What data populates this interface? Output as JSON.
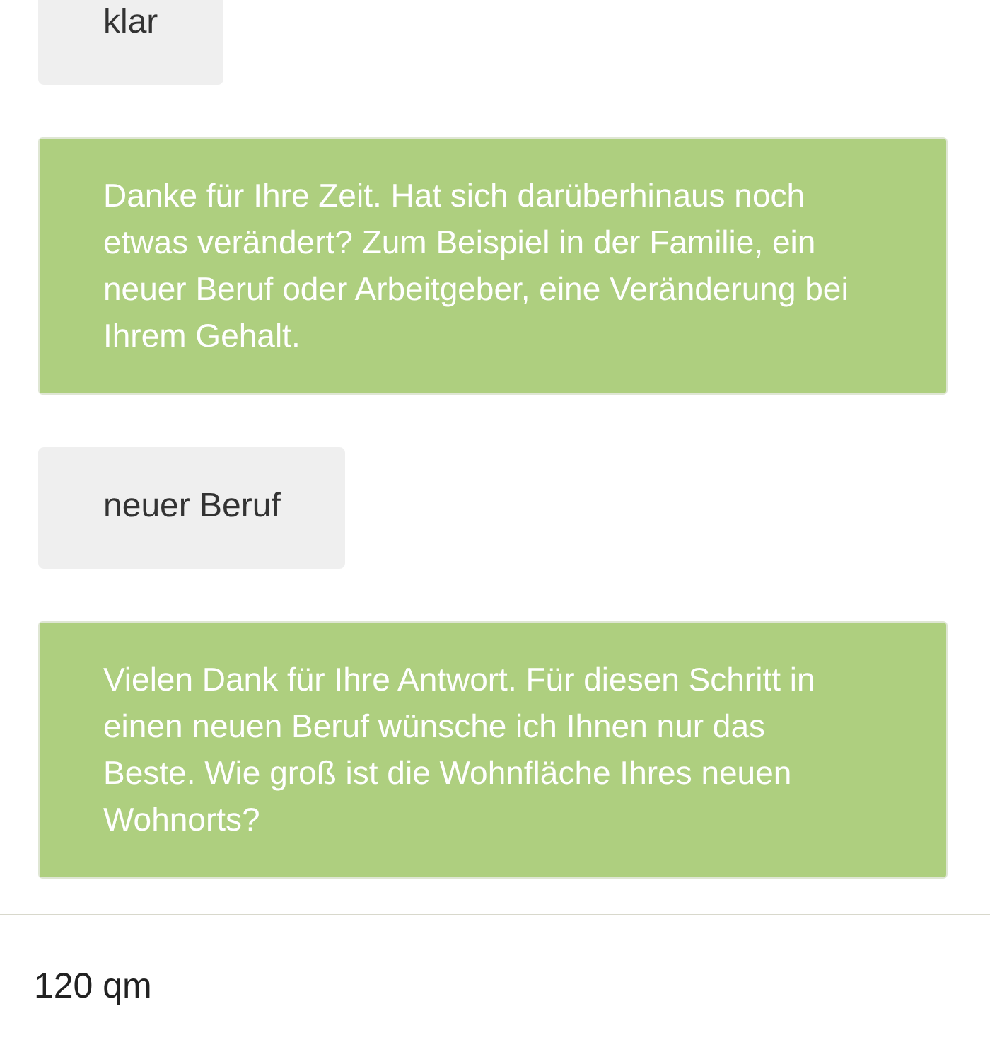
{
  "messages": [
    {
      "kind": "user",
      "text": "klar"
    },
    {
      "kind": "bot",
      "text": "Danke für Ihre Zeit. Hat sich darüberhinaus noch etwas verändert? Zum Beispiel in der Familie, ein neuer Beruf oder Arbeitgeber, eine Veränderung bei Ihrem Gehalt."
    },
    {
      "kind": "user",
      "text": "neuer Beruf"
    },
    {
      "kind": "bot",
      "text": "Vielen Dank für Ihre Antwort. Für diesen Schritt in einen neuen Beruf wünsche ich Ihnen nur das Beste. Wie groß ist die Wohnfläche Ihres neuen Wohnorts?"
    }
  ],
  "input": {
    "value": "120 qm"
  }
}
